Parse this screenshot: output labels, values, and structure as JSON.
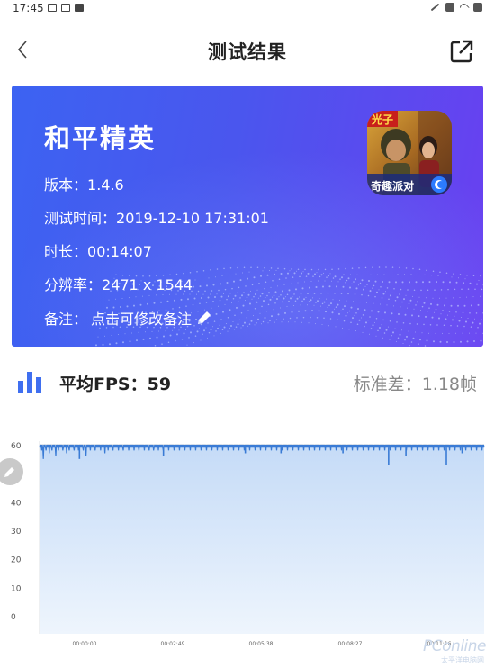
{
  "status_bar": {
    "time": "17:45"
  },
  "header": {
    "title": "测试结果"
  },
  "game": {
    "name": "和平精英",
    "version_label": "版本：",
    "version": "1.4.6",
    "test_time_label": "测试时间：",
    "test_time": "2019-12-10 17:31:01",
    "duration_label": "时长：",
    "duration": "00:14:07",
    "resolution_label": "分辨率：",
    "resolution": "2471 x 1544",
    "note_label": "备注：",
    "note_placeholder": "点击可修改备注",
    "icon_text_top": "光子",
    "icon_text_bottom": "奇趣派对"
  },
  "summary": {
    "avg_fps_label": "平均FPS：",
    "avg_fps": "59",
    "std_label": "标准差：",
    "std": "1.18帧"
  },
  "watermark": {
    "main": "PConline",
    "sub": "太平洋电脑网"
  },
  "colors": {
    "accent": "#3f6ff0",
    "line": "#3a7bd5",
    "fill_top": "#c5dbf7",
    "fill_bottom": "#eef5fd"
  },
  "chart_data": {
    "type": "area",
    "title": "",
    "xlabel": "",
    "ylabel": "",
    "ylim": [
      0,
      60
    ],
    "y_ticks": [
      0,
      10,
      20,
      30,
      40,
      50,
      60
    ],
    "x_ticks": [
      "00:00:00",
      "00:02:49",
      "00:05:38",
      "00:08:27",
      "00:11:16"
    ],
    "x_range_seconds": [
      0,
      847
    ],
    "grid": true,
    "series": [
      {
        "values": [
          59,
          60,
          59,
          60,
          58,
          60,
          59,
          55,
          60,
          59,
          60,
          59,
          58,
          60,
          59,
          60,
          59,
          60,
          57,
          60,
          59,
          60,
          59,
          58,
          60,
          59,
          60,
          59,
          60,
          59,
          56,
          60,
          59,
          60,
          59,
          58,
          60,
          59,
          60,
          59,
          60,
          59,
          60,
          58,
          59,
          60,
          59,
          60,
          59,
          60,
          57,
          60,
          59,
          60,
          59,
          58,
          60,
          59,
          60,
          59,
          60,
          59,
          60,
          59,
          58,
          60,
          59,
          60,
          59,
          60,
          59,
          60,
          58,
          60,
          59,
          60,
          59,
          60,
          59,
          60,
          59,
          58,
          60,
          59,
          60,
          59,
          56,
          60,
          59,
          60,
          59,
          60,
          59,
          60,
          58,
          60,
          59,
          60,
          59,
          60,
          59,
          60,
          59,
          58,
          60,
          59,
          60,
          59,
          60,
          59,
          60,
          59,
          60,
          58,
          60,
          59,
          60,
          59,
          60,
          59,
          60,
          57,
          60,
          59,
          60,
          59,
          60,
          58,
          60,
          59,
          60,
          59,
          60,
          59,
          60,
          59,
          58,
          60,
          59,
          60,
          59,
          60,
          59,
          60,
          59,
          60,
          58,
          60,
          59,
          60,
          59,
          60,
          59,
          60,
          59,
          58,
          60,
          59,
          60,
          59,
          60,
          59,
          60,
          59,
          60,
          58,
          60,
          59,
          60,
          59,
          60,
          59,
          60,
          59,
          60,
          58,
          60,
          59,
          60,
          59,
          60,
          59,
          60,
          59,
          58,
          60,
          59,
          60,
          59,
          60,
          59,
          60,
          59,
          60,
          58,
          60,
          59,
          60,
          59,
          60,
          59,
          60,
          59,
          58,
          60,
          59,
          60,
          59,
          60,
          59,
          60,
          58,
          59,
          60,
          59,
          60,
          59,
          60,
          59,
          60,
          58,
          60,
          59,
          60,
          59,
          60,
          59,
          60,
          59,
          58,
          60,
          59,
          60,
          59,
          60,
          59,
          60,
          59,
          60,
          58,
          60,
          59,
          60,
          59,
          60,
          59,
          60,
          59,
          60,
          58,
          60,
          59,
          60,
          59,
          60,
          59,
          60,
          59,
          60,
          58,
          60,
          59,
          60,
          59,
          60,
          59,
          60,
          59,
          60,
          58,
          60,
          59,
          60,
          59,
          60,
          59,
          60,
          59,
          60,
          58,
          60,
          59,
          60,
          59,
          60,
          59,
          60,
          59,
          60,
          58,
          60,
          59,
          60,
          59,
          60,
          59,
          60,
          59,
          60,
          58,
          60,
          59,
          60,
          59,
          60,
          59,
          60,
          59,
          60,
          58,
          60,
          59,
          60,
          59,
          60,
          59,
          60,
          59,
          60,
          58,
          60,
          59,
          60,
          59,
          60,
          59,
          60,
          59,
          60,
          58,
          60,
          59,
          60,
          59,
          60,
          59,
          60,
          59,
          60,
          58,
          60,
          59,
          60,
          59,
          60,
          59,
          60,
          59,
          60,
          58,
          60,
          59,
          60,
          59,
          60,
          59,
          60,
          59,
          60,
          58,
          60,
          59,
          60,
          59,
          60,
          59,
          60,
          59,
          60,
          58,
          60,
          59,
          60,
          59,
          60,
          59,
          60,
          59,
          60,
          58,
          60,
          59,
          60,
          59,
          60,
          59,
          60,
          59,
          60,
          58,
          60,
          59,
          60,
          59,
          60,
          59,
          60,
          59,
          60,
          58,
          60,
          59,
          60,
          59,
          60,
          59,
          60,
          59,
          60,
          58,
          60,
          59,
          60,
          59,
          60,
          59,
          60,
          59,
          60,
          58,
          60,
          59,
          60,
          59,
          60,
          59,
          60,
          59,
          60,
          58,
          60,
          59,
          60,
          59,
          60,
          59,
          60,
          59,
          60,
          58,
          60,
          59,
          60,
          59,
          60,
          59,
          60,
          59,
          60,
          58,
          60,
          59,
          60,
          59,
          60,
          59,
          60,
          59,
          60,
          58,
          60,
          59,
          60,
          59,
          60,
          59,
          60,
          59,
          60,
          58,
          60,
          59,
          60,
          59,
          60,
          59,
          60,
          59,
          60,
          58,
          60,
          59,
          60,
          59,
          60,
          59,
          60,
          59,
          60,
          58,
          60,
          59,
          60,
          59,
          60,
          59,
          60,
          59,
          60,
          58,
          60,
          59,
          60,
          59,
          60,
          59,
          60,
          59,
          60,
          58,
          60,
          59,
          60,
          59,
          60,
          59,
          60,
          59,
          60,
          58,
          60,
          59,
          60,
          59,
          60,
          59,
          60,
          59,
          60,
          58,
          60,
          59,
          60,
          59,
          60,
          59,
          60,
          59,
          60,
          58,
          60,
          59,
          60,
          59,
          60,
          59,
          60,
          59,
          60,
          58,
          60,
          59,
          60,
          59,
          60,
          59,
          60,
          59,
          60,
          58,
          60,
          59,
          60,
          59,
          60,
          59,
          60,
          59,
          60,
          58,
          60,
          59,
          60,
          59,
          60,
          59,
          60,
          59,
          60,
          58,
          60,
          59,
          60,
          59,
          60,
          59,
          60,
          59,
          60,
          58,
          60,
          59,
          60,
          59,
          60,
          59,
          60,
          59,
          60,
          58,
          60,
          59,
          60,
          59,
          60,
          59,
          60,
          59,
          60,
          58,
          60,
          59,
          60,
          59,
          60,
          59,
          60,
          59,
          60,
          58,
          60,
          59,
          60,
          59,
          60,
          59,
          60,
          59,
          60,
          58,
          60,
          59,
          60,
          59,
          60,
          59,
          60,
          59,
          60,
          58,
          60,
          59,
          60,
          59,
          60,
          59,
          60,
          59,
          60,
          58,
          60,
          59,
          60,
          59,
          60,
          59,
          60,
          59,
          60,
          58,
          60,
          59,
          60,
          59,
          60,
          59,
          60,
          59,
          60,
          58,
          60,
          59,
          60,
          59,
          60,
          59,
          60,
          59,
          60,
          58,
          60,
          59,
          60,
          59,
          60,
          59,
          60,
          59,
          60,
          58,
          60,
          59,
          60,
          59,
          60,
          59,
          60,
          59,
          60,
          58,
          60,
          59,
          60,
          59,
          60,
          59,
          60,
          59,
          60,
          58,
          60,
          59,
          60,
          59,
          60,
          59,
          60,
          59,
          60,
          58,
          60,
          59,
          60,
          59,
          60,
          59,
          60,
          59,
          60,
          58,
          60,
          59,
          60,
          59,
          60,
          59,
          60,
          59,
          60,
          58,
          60,
          59,
          60,
          59,
          60,
          59,
          60,
          59,
          60,
          58,
          60,
          59,
          60,
          59,
          60,
          59,
          60,
          59,
          60,
          58,
          60,
          59,
          60,
          59,
          60,
          59,
          60,
          59,
          60,
          58,
          60,
          59,
          60,
          59,
          60,
          59,
          60,
          59,
          60,
          58,
          60,
          59,
          60,
          59,
          60,
          59,
          60,
          59,
          60,
          58,
          60,
          59,
          60,
          59,
          60,
          59,
          60,
          59,
          60,
          58,
          60,
          59,
          60,
          59,
          60,
          59,
          60,
          59,
          60,
          58,
          60,
          59,
          60,
          59,
          60,
          59,
          60,
          59,
          60,
          58,
          60,
          59,
          60,
          59
        ]
      }
    ],
    "dips": [
      {
        "t": 76,
        "v": 55
      },
      {
        "t": 236,
        "v": 56
      },
      {
        "t": 392,
        "v": 57
      },
      {
        "t": 460,
        "v": 57
      },
      {
        "t": 578,
        "v": 57
      },
      {
        "t": 665,
        "v": 53
      },
      {
        "t": 698,
        "v": 56
      },
      {
        "t": 775,
        "v": 53
      },
      {
        "t": 805,
        "v": 57
      }
    ]
  }
}
